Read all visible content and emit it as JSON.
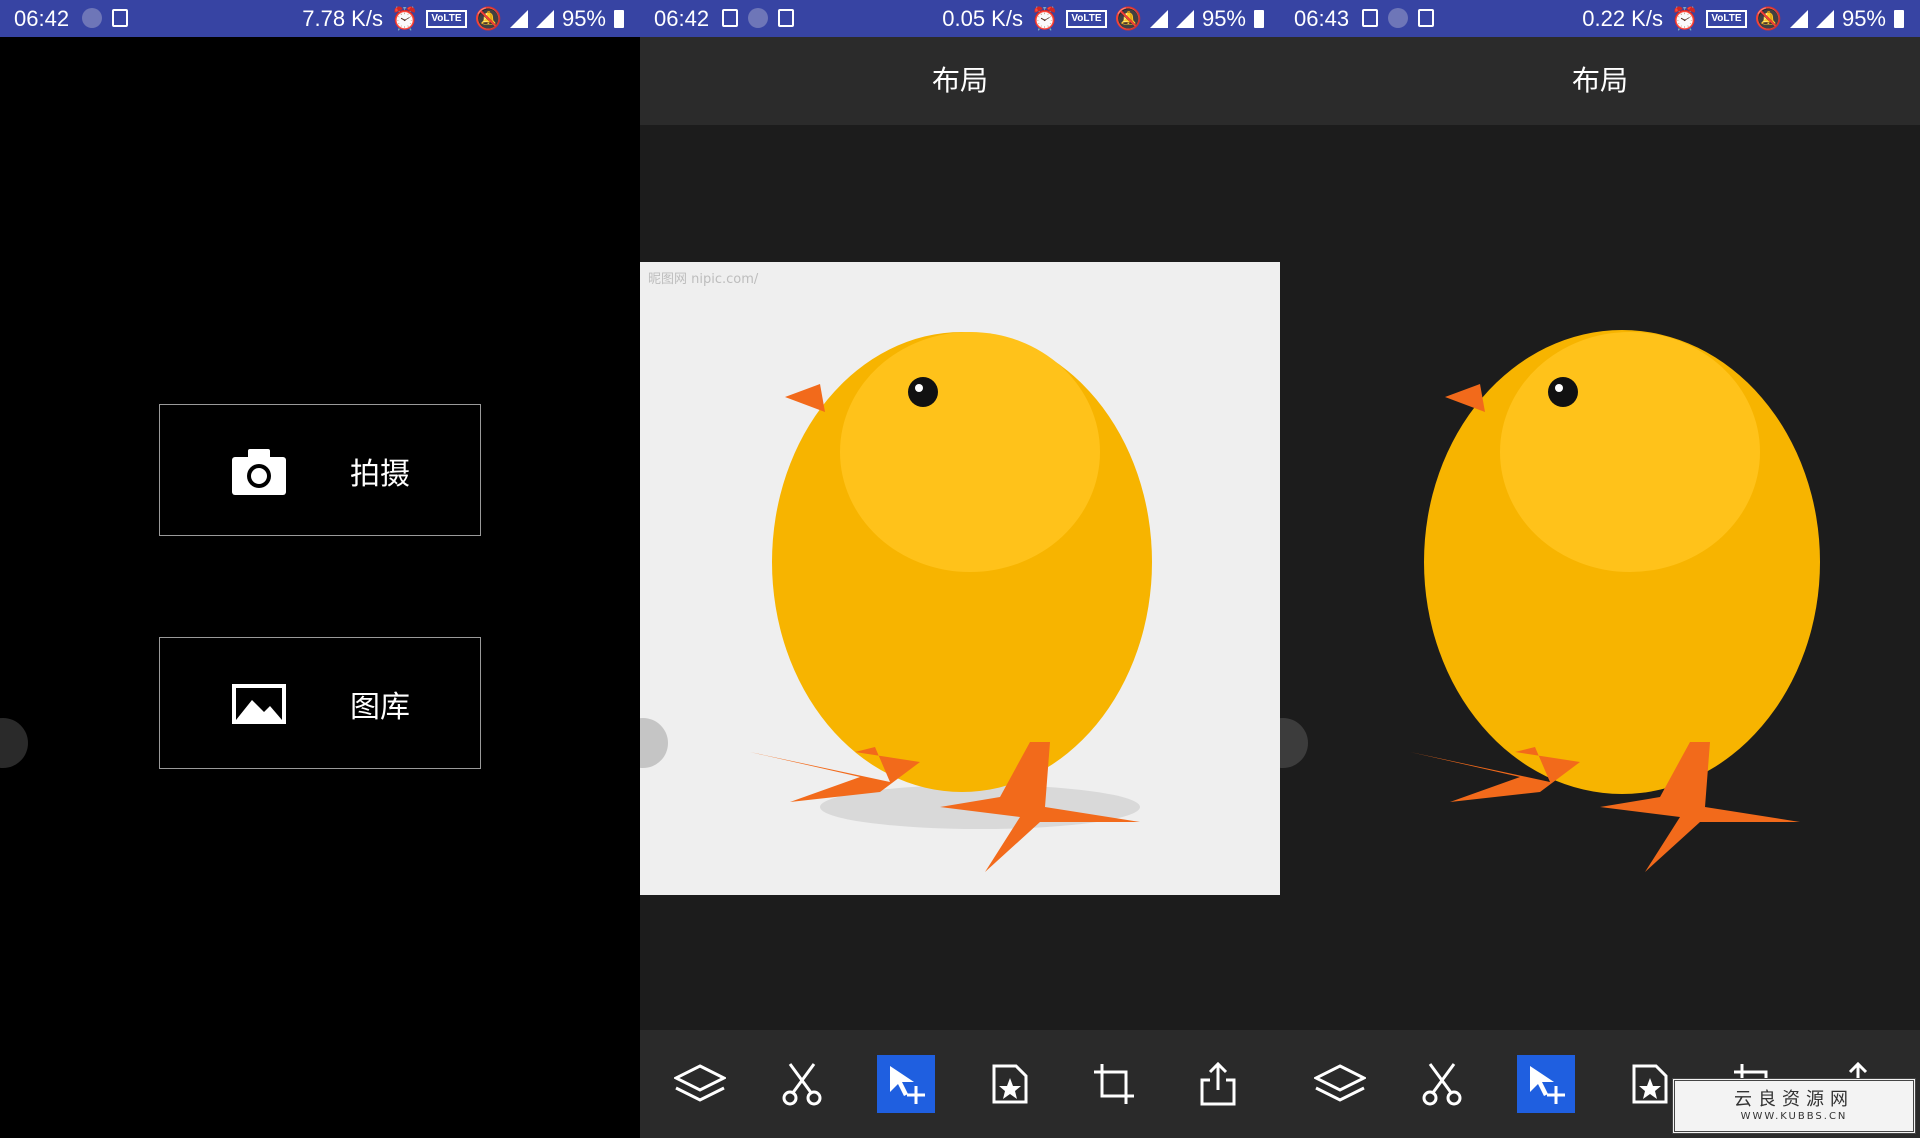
{
  "status_bars": [
    {
      "time": "06:42",
      "speed": "7.78 K/s",
      "volte": "VoLTE",
      "battery": "95%"
    },
    {
      "time": "06:42",
      "speed": "0.05 K/s",
      "volte": "VoLTE",
      "battery": "95%"
    },
    {
      "time": "06:43",
      "speed": "0.22 K/s",
      "volte": "VoLTE",
      "battery": "95%"
    }
  ],
  "screen1": {
    "camera_label": "拍摄",
    "gallery_label": "图库"
  },
  "screen2": {
    "title": "布局",
    "watermark": "昵图网 nipic.com/"
  },
  "screen3": {
    "title": "布局"
  },
  "toolbar": {
    "icons": [
      "layers-icon",
      "scissors-icon",
      "move-icon",
      "sticker-icon",
      "crop-icon",
      "share-icon"
    ],
    "active_index": 2
  },
  "overlay": {
    "site_title": "云良资源网",
    "site_url": "WWW.KUBBS.CN"
  },
  "colors": {
    "statusbar": "#3744a3",
    "accent": "#1f5fe0",
    "chick_yellow": "#f7b400",
    "chick_orange": "#f26a1b"
  }
}
